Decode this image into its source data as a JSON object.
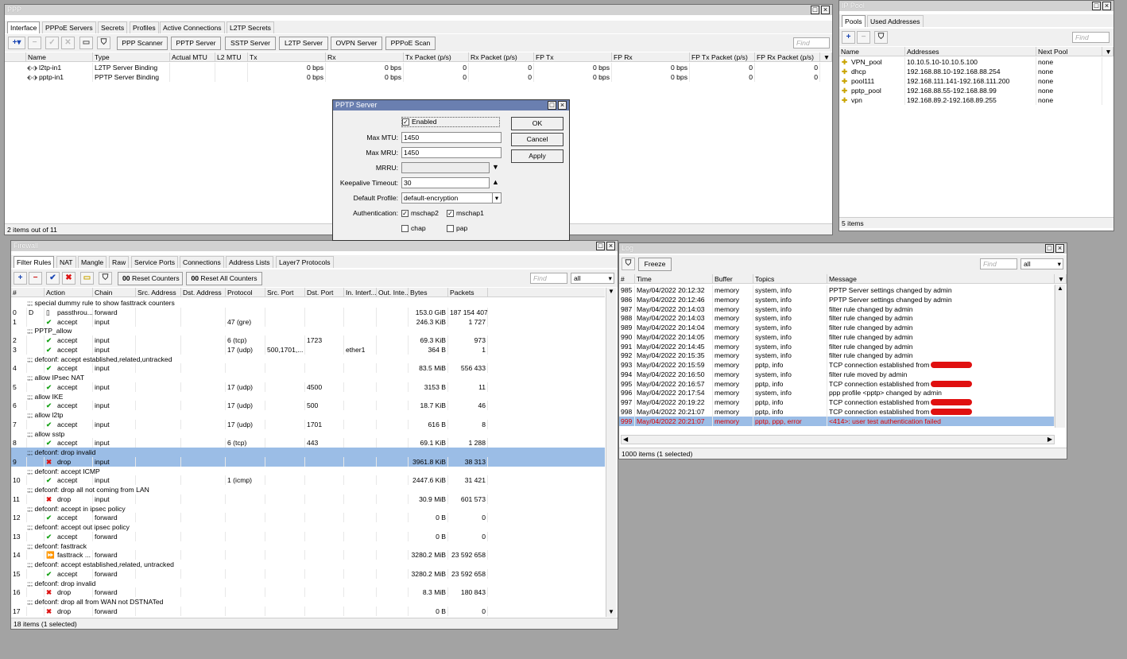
{
  "ppp": {
    "title": "PPP",
    "tabs": [
      "Interface",
      "PPPoE Servers",
      "Secrets",
      "Profiles",
      "Active Connections",
      "L2TP Secrets"
    ],
    "buttons": [
      "PPP Scanner",
      "PPTP Server",
      "SSTP Server",
      "L2TP Server",
      "OVPN Server",
      "PPPoE Scan"
    ],
    "find": "Find",
    "columns": [
      "Name",
      "Type",
      "Actual MTU",
      "L2 MTU",
      "Tx",
      "Rx",
      "Tx Packet (p/s)",
      "Rx Packet (p/s)",
      "FP Tx",
      "FP Rx",
      "FP Tx Packet (p/s)",
      "FP Rx Packet (p/s)"
    ],
    "rows": [
      [
        "l2tp-in1",
        "L2TP Server Binding",
        "",
        "",
        "0 bps",
        "0 bps",
        "0",
        "0",
        "0 bps",
        "0 bps",
        "0",
        "0"
      ],
      [
        "pptp-in1",
        "PPTP Server Binding",
        "",
        "",
        "0 bps",
        "0 bps",
        "0",
        "0",
        "0 bps",
        "0 bps",
        "0",
        "0"
      ]
    ],
    "status": "2 items out of 11"
  },
  "ippool": {
    "title": "IP Pool",
    "tabs": [
      "Pools",
      "Used Addresses"
    ],
    "find": "Find",
    "columns": [
      "Name",
      "Addresses",
      "Next Pool"
    ],
    "rows": [
      [
        "VPN_pool",
        "10.10.5.10-10.10.5.100",
        "none"
      ],
      [
        "dhcp",
        "192.168.88.10-192.168.88.254",
        "none"
      ],
      [
        "pool111",
        "192.168.111.141-192.168.111.200",
        "none"
      ],
      [
        "pptp_pool",
        "192.168.88.55-192.168.88.99",
        "none"
      ],
      [
        "vpn",
        "192.168.89.2-192.168.89.255",
        "none"
      ]
    ],
    "status": "5 items"
  },
  "pptp": {
    "title": "PPTP Server",
    "enabled": "Enabled",
    "max_mtu_label": "Max MTU:",
    "max_mtu": "1450",
    "max_mru_label": "Max MRU:",
    "max_mru": "1450",
    "mrru_label": "MRRU:",
    "keepalive_label": "Keepalive Timeout:",
    "keepalive": "30",
    "profile_label": "Default Profile:",
    "profile": "default-encryption",
    "auth_label": "Authentication:",
    "auth": [
      "mschap2",
      "mschap1",
      "chap",
      "pap"
    ],
    "ok": "OK",
    "cancel": "Cancel",
    "apply": "Apply"
  },
  "firewall": {
    "title": "Firewall",
    "tabs": [
      "Filter Rules",
      "NAT",
      "Mangle",
      "Raw",
      "Service Ports",
      "Connections",
      "Address Lists",
      "Layer7 Protocols"
    ],
    "reset_counters": "Reset Counters",
    "reset_all": "Reset All Counters",
    "find": "Find",
    "filter_value": "all",
    "counter_icon": "00",
    "columns": [
      "#",
      "Action",
      "Chain",
      "Src. Address",
      "Dst. Address",
      "Protocol",
      "Src. Port",
      "Dst. Port",
      "In. Interf...",
      "Out. Inte...",
      "Bytes",
      "Packets"
    ],
    "rows": [
      {
        "c": ";;; special dummy rule to show fasttrack counters"
      },
      {
        "n": "0",
        "flag": "D",
        "icon": "passthrough",
        "a": "passthrou...",
        "ch": "forward",
        "b": "153.0 GiB",
        "p": "187 154 407"
      },
      {
        "n": "1",
        "icon": "accept",
        "a": "accept",
        "ch": "input",
        "pr": "47 (gre)",
        "b": "246.3 KiB",
        "p": "1 727"
      },
      {
        "c": ";;; PPTP_allow"
      },
      {
        "n": "2",
        "icon": "accept",
        "a": "accept",
        "ch": "input",
        "pr": "6 (tcp)",
        "dp": "1723",
        "b": "69.3 KiB",
        "p": "973"
      },
      {
        "n": "3",
        "icon": "accept",
        "a": "accept",
        "ch": "input",
        "pr": "17 (udp)",
        "sp": "500,1701,...",
        "ii": "ether1",
        "b": "364 B",
        "p": "1"
      },
      {
        "c": ";;; defconf: accept established,related,untracked"
      },
      {
        "n": "4",
        "icon": "accept",
        "a": "accept",
        "ch": "input",
        "b": "83.5 MiB",
        "p": "556 433"
      },
      {
        "c": ";;; allow IPsec NAT"
      },
      {
        "n": "5",
        "icon": "accept",
        "a": "accept",
        "ch": "input",
        "pr": "17 (udp)",
        "dp": "4500",
        "b": "3153 B",
        "p": "11"
      },
      {
        "c": ";;; allow IKE"
      },
      {
        "n": "6",
        "icon": "accept",
        "a": "accept",
        "ch": "input",
        "pr": "17 (udp)",
        "dp": "500",
        "b": "18.7 KiB",
        "p": "46"
      },
      {
        "c": ";;; allow l2tp"
      },
      {
        "n": "7",
        "icon": "accept",
        "a": "accept",
        "ch": "input",
        "pr": "17 (udp)",
        "dp": "1701",
        "b": "616 B",
        "p": "8"
      },
      {
        "c": ";;; allow sstp"
      },
      {
        "n": "8",
        "icon": "accept",
        "a": "accept",
        "ch": "input",
        "pr": "6 (tcp)",
        "dp": "443",
        "b": "69.1 KiB",
        "p": "1 288"
      },
      {
        "c": ";;; defconf: drop invalid",
        "sel": true
      },
      {
        "n": "9",
        "icon": "drop",
        "a": "drop",
        "ch": "input",
        "b": "3961.8 KiB",
        "p": "38 313",
        "sel": true
      },
      {
        "c": ";;; defconf: accept ICMP"
      },
      {
        "n": "10",
        "icon": "accept",
        "a": "accept",
        "ch": "input",
        "pr": "1 (icmp)",
        "b": "2447.6 KiB",
        "p": "31 421"
      },
      {
        "c": ";;; defconf: drop all not coming from LAN"
      },
      {
        "n": "11",
        "icon": "drop",
        "a": "drop",
        "ch": "input",
        "b": "30.9 MiB",
        "p": "601 573"
      },
      {
        "c": ";;; defconf: accept in ipsec policy"
      },
      {
        "n": "12",
        "icon": "accept",
        "a": "accept",
        "ch": "forward",
        "b": "0 B",
        "p": "0"
      },
      {
        "c": ";;; defconf: accept out ipsec policy"
      },
      {
        "n": "13",
        "icon": "accept",
        "a": "accept",
        "ch": "forward",
        "b": "0 B",
        "p": "0"
      },
      {
        "c": ";;; defconf: fasttrack"
      },
      {
        "n": "14",
        "icon": "fasttrack",
        "a": "fasttrack ...",
        "ch": "forward",
        "b": "3280.2 MiB",
        "p": "23 592 658"
      },
      {
        "c": ";;; defconf: accept established,related, untracked"
      },
      {
        "n": "15",
        "icon": "accept",
        "a": "accept",
        "ch": "forward",
        "b": "3280.2 MiB",
        "p": "23 592 658"
      },
      {
        "c": ";;; defconf: drop invalid"
      },
      {
        "n": "16",
        "icon": "drop",
        "a": "drop",
        "ch": "forward",
        "b": "8.3 MiB",
        "p": "180 843"
      },
      {
        "c": ";;; defconf:  drop all from WAN not DSTNATed"
      },
      {
        "n": "17",
        "icon": "drop",
        "a": "drop",
        "ch": "forward",
        "b": "0 B",
        "p": "0"
      }
    ],
    "status": "18 items (1 selected)"
  },
  "log": {
    "title": "Log",
    "freeze": "Freeze",
    "find": "Find",
    "filter_value": "all",
    "columns": [
      "#",
      "Time",
      "Buffer",
      "Topics",
      "Message"
    ],
    "rows": [
      [
        "985",
        "May/04/2022 20:12:32",
        "memory",
        "system, info",
        "PPTP Server settings changed by admin"
      ],
      [
        "986",
        "May/04/2022 20:12:46",
        "memory",
        "system, info",
        "PPTP Server settings changed by admin"
      ],
      [
        "987",
        "May/04/2022 20:14:03",
        "memory",
        "system, info",
        "filter rule changed by admin"
      ],
      [
        "988",
        "May/04/2022 20:14:03",
        "memory",
        "system, info",
        "filter rule changed by admin"
      ],
      [
        "989",
        "May/04/2022 20:14:04",
        "memory",
        "system, info",
        "filter rule changed by admin"
      ],
      [
        "990",
        "May/04/2022 20:14:05",
        "memory",
        "system, info",
        "filter rule changed by admin"
      ],
      [
        "991",
        "May/04/2022 20:14:45",
        "memory",
        "system, info",
        "filter rule changed by admin"
      ],
      [
        "992",
        "May/04/2022 20:15:35",
        "memory",
        "system, info",
        "filter rule changed by admin"
      ],
      [
        "993",
        "May/04/2022 20:15:59",
        "memory",
        "pptp, info",
        "TCP connection established from"
      ],
      [
        "994",
        "May/04/2022 20:16:50",
        "memory",
        "system, info",
        "filter rule moved by admin"
      ],
      [
        "995",
        "May/04/2022 20:16:57",
        "memory",
        "pptp, info",
        "TCP connection established from"
      ],
      [
        "996",
        "May/04/2022 20:17:54",
        "memory",
        "system, info",
        "ppp profile <pptp> changed by admin"
      ],
      [
        "997",
        "May/04/2022 20:19:22",
        "memory",
        "pptp, info",
        "TCP connection established from"
      ],
      [
        "998",
        "May/04/2022 20:21:07",
        "memory",
        "pptp, info",
        "TCP connection established from"
      ],
      [
        "999",
        "May/04/2022 20:21:07",
        "memory",
        "pptp, ppp, error",
        "<414>: user test authentication failed"
      ]
    ],
    "status": "1000 items (1 selected)"
  }
}
